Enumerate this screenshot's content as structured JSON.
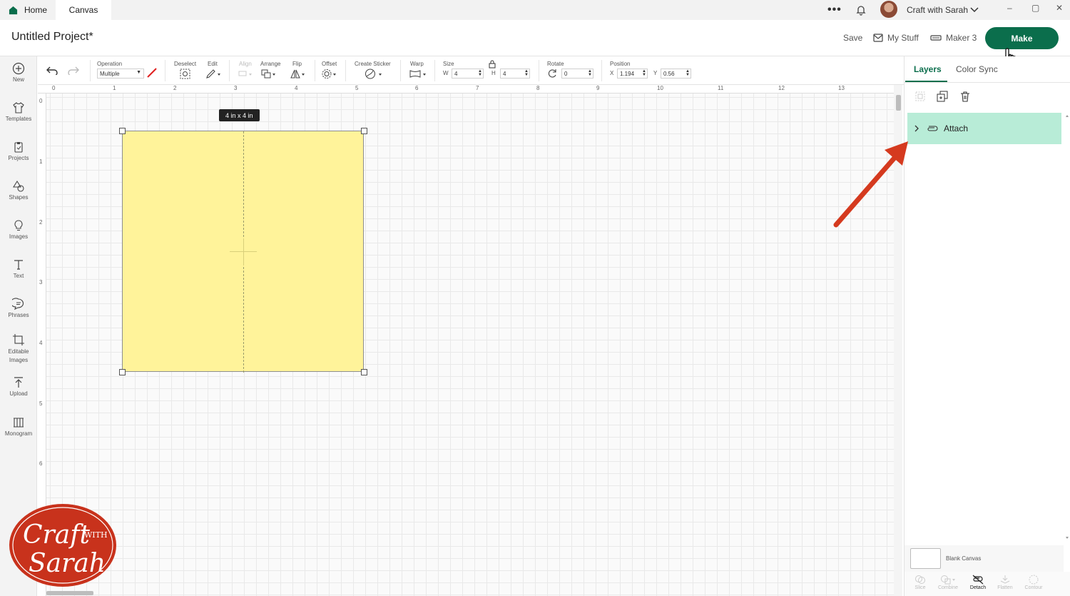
{
  "titlebar": {
    "tabs": [
      {
        "label": "Home"
      },
      {
        "label": "Canvas"
      }
    ],
    "account_name": "Craft with Sarah",
    "window_controls": [
      "–",
      "▢",
      "✕"
    ]
  },
  "header": {
    "project_title": "Untitled Project*",
    "save_label": "Save",
    "my_stuff_label": "My Stuff",
    "machine_label": "Maker 3",
    "make_label": "Make"
  },
  "sidebar": {
    "items": [
      {
        "label": "New"
      },
      {
        "label": "Templates"
      },
      {
        "label": "Projects"
      },
      {
        "label": "Shapes"
      },
      {
        "label": "Images"
      },
      {
        "label": "Text"
      },
      {
        "label": "Phrases"
      },
      {
        "label": "Editable Images"
      },
      {
        "label": "Upload"
      },
      {
        "label": "Monogram"
      }
    ]
  },
  "toolbar": {
    "operation_label": "Operation",
    "operation_value": "Multiple",
    "deselect_label": "Deselect",
    "edit_label": "Edit",
    "align_label": "Align",
    "arrange_label": "Arrange",
    "flip_label": "Flip",
    "offset_label": "Offset",
    "create_sticker_label": "Create Sticker",
    "warp_label": "Warp",
    "size_label": "Size",
    "size_w_label": "W",
    "size_w_value": "4",
    "size_h_label": "H",
    "size_h_value": "4",
    "rotate_label": "Rotate",
    "rotate_value": "0",
    "position_label": "Position",
    "position_x_label": "X",
    "position_x_value": "1.194",
    "position_y_label": "Y",
    "position_y_value": "0.56"
  },
  "rulers": {
    "top": [
      "0",
      "1",
      "2",
      "3",
      "4",
      "5",
      "6",
      "7",
      "8",
      "9",
      "10",
      "11",
      "12",
      "13"
    ],
    "left": [
      "0",
      "1",
      "2",
      "3",
      "4",
      "5",
      "6"
    ]
  },
  "canvas": {
    "size_tag": "4 in x 4 in",
    "shape_fill": "#fff39a"
  },
  "right_panel": {
    "tab_layers": "Layers",
    "tab_color_sync": "Color Sync",
    "layer_group_label": "Attach",
    "blank_canvas_label": "Blank Canvas",
    "bottom_tools": [
      {
        "label": "Slice"
      },
      {
        "label": "Combine"
      },
      {
        "label": "Detach"
      },
      {
        "label": "Flatten"
      },
      {
        "label": "Contour"
      }
    ]
  },
  "logo": {
    "text_main": "Craft",
    "text_with": "WITH",
    "text_name": "Sarah"
  },
  "colors": {
    "accent": "#0b6e4c",
    "layer_highlight": "#b8ecd7",
    "arrow": "#d53a1f",
    "logo": "#c8321c"
  }
}
